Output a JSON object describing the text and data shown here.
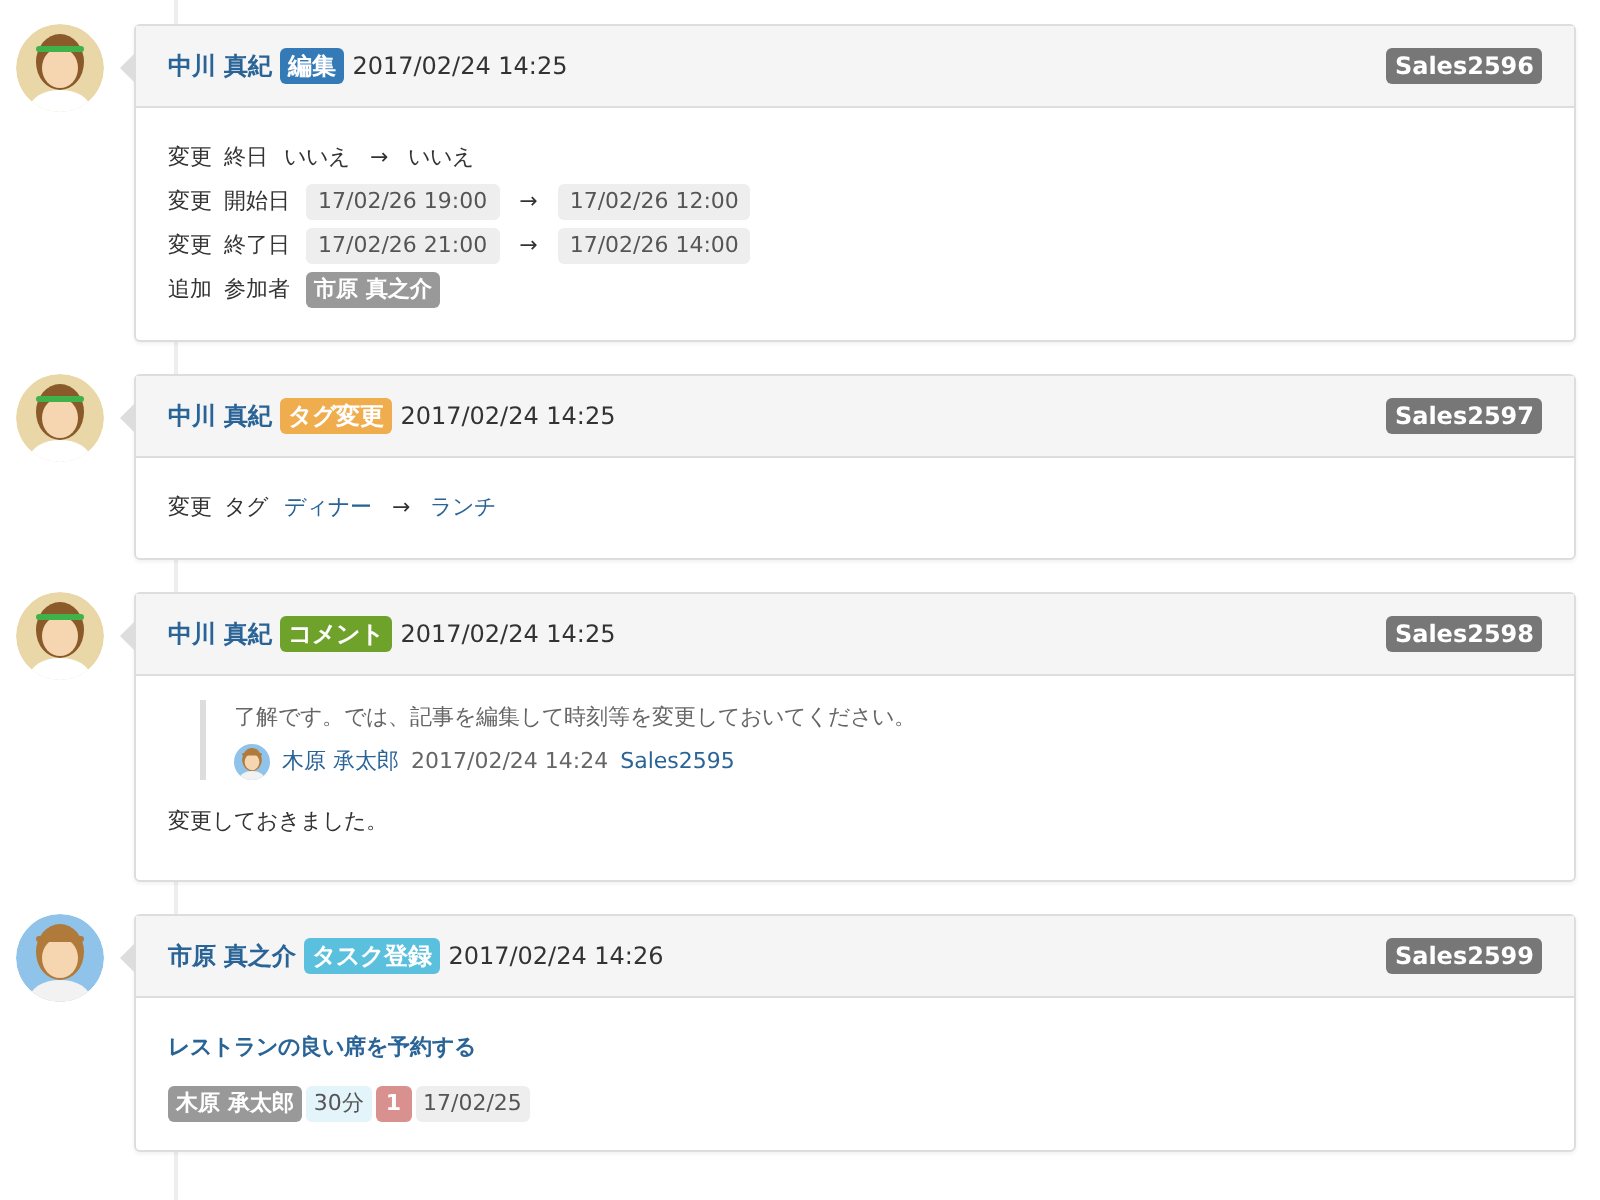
{
  "entries": [
    {
      "author": "中川 真紀",
      "action": "編集",
      "color": "#337ab7",
      "time": "2017/02/24 14:25",
      "id": "Sales2596",
      "body": {
        "kind": "changes",
        "lines": [
          {
            "kind": "change",
            "verb": "変更",
            "field": "終日",
            "from": "いいえ",
            "arrow": "→",
            "to": "いいえ"
          },
          {
            "kind": "time_change",
            "verb": "変更",
            "field": "開始日",
            "from": "17/02/26 19:00",
            "arrow": "→",
            "to": "17/02/26 12:00"
          },
          {
            "kind": "time_change",
            "verb": "変更",
            "field": "終了日",
            "from": "17/02/26 21:00",
            "arrow": "→",
            "to": "17/02/26 14:00"
          },
          {
            "kind": "add",
            "verb": "追加",
            "field": "参加者",
            "value": "市原 真之介"
          }
        ]
      }
    },
    {
      "author": "中川 真紀",
      "action": "タグ変更",
      "color": "#f0ad4e",
      "time": "2017/02/24 14:25",
      "id": "Sales2597",
      "body": {
        "kind": "changes",
        "lines": [
          {
            "kind": "tag_change",
            "verb": "変更",
            "field": "タグ",
            "from": "ディナー",
            "arrow": "→",
            "to": "ランチ"
          }
        ]
      }
    },
    {
      "author": "中川 真紀",
      "action": "コメント",
      "color": "#6fa22a",
      "time": "2017/02/24 14:25",
      "id": "Sales2598",
      "body": {
        "kind": "comment",
        "quote": {
          "text": "了解です。では、記事を編集して時刻等を変更しておいてください。",
          "author": "木原 承太郎",
          "time": "2017/02/24 14:24",
          "link": "Sales2595"
        },
        "message": "変更しておきました。"
      }
    },
    {
      "author": "市原 真之介",
      "action": "タスク登録",
      "color": "#5bc0de",
      "time": "2017/02/24 14:26",
      "id": "Sales2599",
      "body": {
        "kind": "task",
        "title": "レストランの良い席を予約する",
        "assignee": "木原 承太郎",
        "duration": "30分",
        "priority": "1",
        "due": "17/02/25"
      }
    }
  ]
}
